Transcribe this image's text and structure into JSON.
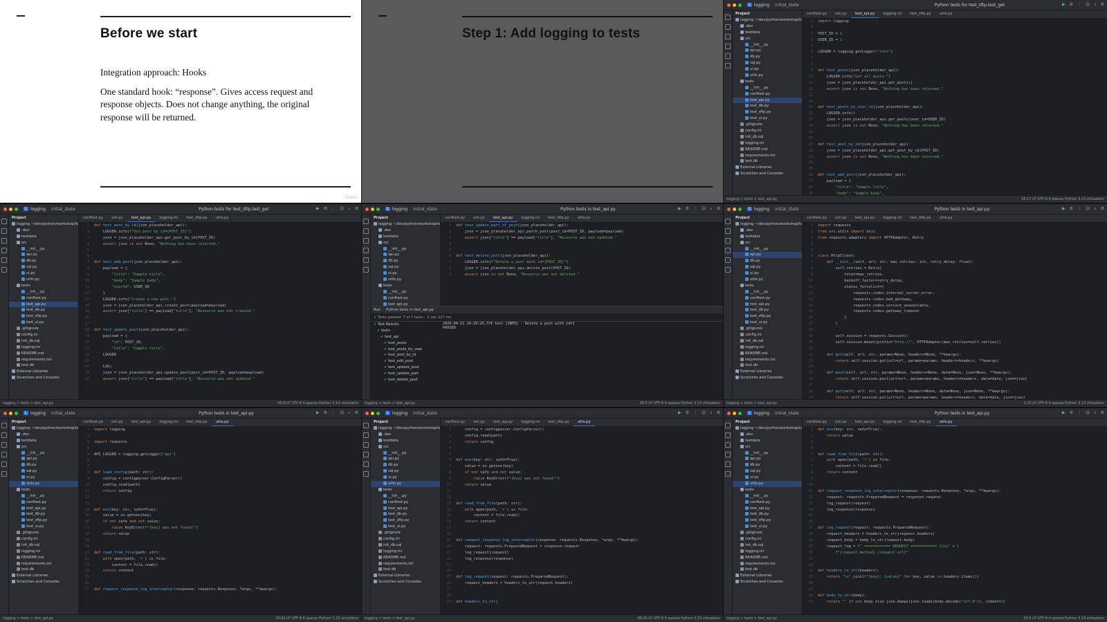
{
  "slides": [
    {
      "theme": "light",
      "title": "Before we start",
      "paragraphs": [
        "Integration approach: Hooks",
        "One standard hook: “response”. Gives access request and response objects. Does not change anything, the original response will be returned."
      ],
      "page_number": "5/xxx"
    },
    {
      "theme": "dark",
      "title": "Step 1: Add logging to tests",
      "paragraphs": [],
      "page_number": ""
    }
  ],
  "ide": {
    "project_name": "logging",
    "project_badge": "L",
    "branch": "initial_state",
    "project_label": "Project",
    "tree": [
      "logging  ~/dev/python/workshop/logging",
      ".dev",
      "testdata",
      "src",
      "__init__.py",
      "api.py",
      "db.py",
      "sql.py",
      "ui.py",
      "utils.py",
      "tests",
      "__init__.py",
      "conftest.py",
      "test_api.py",
      "test_db.py",
      "test_sftp.py",
      "test_ui.py",
      ".gitignore",
      "config.ini",
      "init_db.sql",
      "logging.ini",
      "README.md",
      "requirements.txt",
      "test.db",
      "External Libraries",
      "Scratches and Consoles"
    ],
    "tabs": [
      "conftest.py",
      "ssh.py",
      "test_api.py",
      "logging.ini",
      "test_sftp.py",
      "utils.py",
      "api.py"
    ],
    "status_left": "logging > tests > test_api.py",
    "status_right": "16:17   LF   UTF-8   4 spaces   Python 3.13 virtualenv  ...on/workshops/logging/.venv",
    "run_config_title": "Python tests for test_sftp.test_get",
    "run_config_title_api": "Python tests in test_api.py"
  },
  "panels": [
    {
      "id": "p1",
      "active_tab": "test_api.py",
      "run_config": "Python tests for test_sftp.test_get",
      "selected_tree": "test_api.py",
      "lines": [
        "import logging",
        "",
        "POST_ID = 1",
        "USER_ID = 1",
        "",
        "LOGGER = logging.getLogger(\"test\")",
        "",
        "",
        "def test_posts(json_placeholder_api):",
        "    LOGGER.info(\"Get all posts.\")",
        "    json = json_placeholder_api.get_posts()",
        "    assert json is not None, \"Nothing has been returned.\"",
        "",
        "",
        "def test_posts_by_user_id(json_placeholder_api):",
        "    LOGGER.info()",
        "    json = json_placeholder_api.get_posts(user_id=USER_ID)",
        "    assert json is not None, \"Nothing has been returned.\"",
        "",
        "",
        "def test_post_by_id(json_placeholder_api):",
        "    json = json_placeholder_api.get_post_by_id(POST_ID)",
        "    assert json is not None, \"Nothing has been returned.\"",
        "",
        "",
        "def test_add_post(json_placeholder_api):",
        "    payload = {",
        "        \"title\": \"Sample title\",",
        "        \"body\": \"Sample body\",",
        "        \"userId\": USER_ID"
      ],
      "status": "16:17"
    },
    {
      "id": "p2",
      "active_tab": "test_api.py",
      "run_config": "Python tests for test_sftp.test_get",
      "selected_tree": "test_api.py",
      "lines": [
        "def test_post_by_id(json_placeholder_api):",
        "    LOGGER.info(f\"Get post by id={POST_ID}\")",
        "    json = json_placeholder_api.get_post_by_id(POST_ID)",
        "    assert json is not None, \"Nothing has been returned.\"",
        "",
        "",
        "def test_add_post(json_placeholder_api):",
        "    payload = {",
        "        \"title\": \"Sample title\",",
        "        \"body\": \"Sample body\",",
        "        \"userId\": USER_ID",
        "    }",
        "    LOGGER.info(\"Create a new post.\")",
        "    json = json_placeholder_api.create_post(payload=payload)",
        "    assert json[\"title\"] == payload[\"title\"], \"Resource was not created.\"",
        "",
        "",
        "def test_update_post(json_placeholder_api):",
        "    payload = {",
        "        \"id\": POST_ID,",
        "        \"title\": \"Sample title\",",
        "    LOGGER",
        "",
        "    LOG|",
        "    json = json_placeholder_api.update_post(post_id=POST_ID, payload=payload)",
        "    assert json[\"title\"] == payload[\"title\"], \"Resource was not updated.\""
      ],
      "status": "45:8"
    },
    {
      "id": "p3",
      "active_tab": "test_api.py",
      "run_config": "Python tests in test_api.py",
      "selected_tree": "",
      "lines": [
        "def test_update_part_of_post(json_placeholder_api):",
        "    json = json_placeholder_api.patch_post(post_id=POST_ID, payload=payload)",
        "    assert json[\"title\"] == payload[\"title\"], \"Resource was not updated.\"",
        "",
        "",
        "def test_delete_post(json_placeholder_api):",
        "    LOGGER.info(f\"Delete a post with id={POST_ID}\")",
        "    json = json_placeholder_api.delete_post(POST_ID)",
        "    assert json is not None, \"Resource was not deleted.\""
      ],
      "run": {
        "header": "Run",
        "config": "Python tests in test_api.py",
        "summary": "Tests passed: 7 of 7 tests – 1 sec 227 ms",
        "tree": [
          "Test Results",
          "tests",
          "test_api",
          "test_posts",
          "test_posts_by_user",
          "test_post_by_id",
          "test_add_post",
          "test_update_post",
          "test_update_part",
          "test_delete_post"
        ],
        "output": [
          "2025-04-11 14:19:23,774 test [INFO] - Delete a post with id=1",
          "PASSED"
        ]
      },
      "status": "38:5"
    },
    {
      "id": "p4",
      "active_tab": "api.py",
      "run_config": "Python tests in test_api.py",
      "selected_tree": "api.py",
      "lines": [
        "import requests",
        "from src.utils import util",
        "from requests.adapters import HTTPAdapter, Retry",
        "",
        "",
        "class HttpClient:",
        "    def __init__(self, url: str, max_retries: int, retry_delay: float):",
        "        self.retries = Retry(",
        "            total=max_retries,",
        "            backoff_factor=retry_delay,",
        "            status_forcelist=[",
        "                requests.codes.internal_server_error,",
        "                requests.codes.bad_gateway,",
        "                requests.codes.service_unavailable,",
        "                requests.codes.gateway_timeout",
        "            ]",
        "        )",
        "",
        "        self.session = requests.Session()",
        "        self.session.mount(prefix=\"http://\", HTTPAdapter(max_retries=self.retries))",
        "",
        "    def get(self, url: str, params=None, headers=None, **kwargs):",
        "        return self.session.get(url=url, params=params, headers=headers, **kwargs)",
        "",
        "    def post(self, url: str, params=None, headers=None, data=None, json=None, **kwargs):",
        "        return self.session.post(url=url, params=params, headers=headers, data=data, json=json)",
        "",
        "    def put(self, url: str, params=None, headers=None, data=None, json=None, **kwargs):",
        "        return self.session.put(url=url, params=params, headers=headers, data=data, json=json)"
      ],
      "status": "2:25"
    },
    {
      "id": "p5",
      "active_tab": "utils.py",
      "run_config": "Python tests in test_api.py",
      "selected_tree": "utils.py",
      "lines": [
        "import logging",
        "",
        "import requests",
        "",
        "API_LOGGER = logging.getLogger(\"api\")",
        "",
        "",
        "def load_config(path: str):",
        "    config = configparser.ConfigParser()",
        "    config.read(path)",
        "    return config",
        "",
        "",
        "def env(key: str, safe=True):",
        "    value = os.getenv(key)",
        "    if not safe and not value:",
        "        raise KeyError(f\"{key} was not found!\")",
        "    return value",
        "",
        "",
        "def read_from_file(path: str):",
        "    with open(path, 'r') as file:",
        "        content = file.read()",
        "    return content",
        "",
        "",
        "def request_response_log_interceptor(response: requests.Response, *args, **kwargs):"
      ],
      "status": "29:82"
    },
    {
      "id": "p6",
      "active_tab": "utils.py",
      "run_config": "",
      "selected_tree": "utils.py",
      "lines": [
        "    config = configparser.ConfigParser()",
        "    config.read(path)",
        "    return config",
        "",
        "",
        "def env(key: str, safe=True):",
        "    value = os.getenv(key)",
        "    if not safe and not value:",
        "        raise KeyError(f\"{key} was not found!\")",
        "    return value",
        "",
        "",
        "def read_from_file(path: str):",
        "    with open(path, 'r') as file:",
        "        content = file.read()",
        "    return content",
        "",
        "",
        "def request_response_log_interceptor(response: requests.Response, *args, **kwargs):",
        "    request: requests.PreparedRequest = response.request",
        "    log_request(request)",
        "    log_response(response)",
        "",
        "",
        "def log_request(request: requests.PreparedRequest):",
        "    request_headers = headers_to_str(request.headers)",
        "",
        "",
        "def headers_to_str|"
      ],
      "status": "38:20"
    },
    {
      "id": "p7",
      "active_tab": "utils.py",
      "run_config": "Python tests in test_api.py",
      "selected_tree": "utils.py",
      "lines": [
        "def env(key: str, safe=True):",
        "    return value",
        "",
        "",
        "def read_from_file(path: str):",
        "    with open(path, 'r') as file:",
        "        content = file.read()",
        "    return content",
        "",
        "",
        "def request_response_log_interceptor(response: requests.Response, *args, **kwargs):",
        "    request: requests.PreparedRequest = response.request",
        "    log_request(request)",
        "    log_response(response)",
        "",
        "",
        "def log_request(request: requests.PreparedRequest):",
        "    request_headers = headers_to_str(request.headers)",
        "    request_body = body_to_str(request.body)",
        "    request_log = f\" ============ REQUEST ============ {\\n}\" + \\",
        "        f\"{request.method} {request.url}\"",
        "",
        "",
        "def headers_to_str(headers):",
        "    return \"\\n\".join(f\"{key}: {value}\" for key, value in headers.items())",
        "",
        "",
        "def body_to_str(body):",
        "    return \"\" if not body else json.dumps(json.loads(body.decode(\"utf-8\")), indent=2)"
      ],
      "status": "35:5"
    }
  ]
}
